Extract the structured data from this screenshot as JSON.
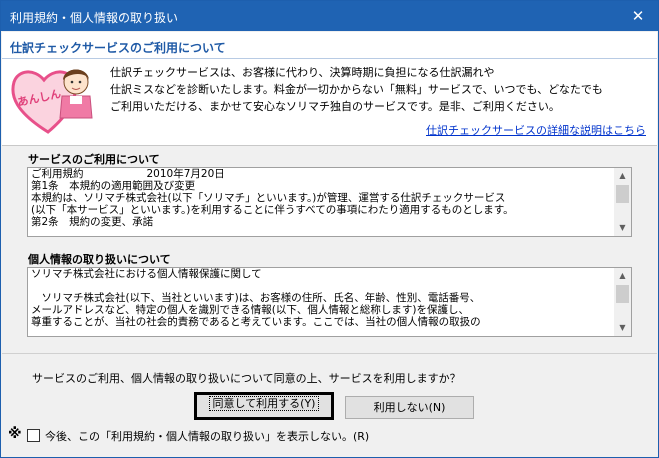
{
  "window": {
    "title": "利用規約・個人情報の取り扱い",
    "close_glyph": "✕"
  },
  "banner": {
    "heading": "仕訳チェックサービスのご利用について",
    "mascot_text": "あんしん",
    "lines": [
      "仕訳チェックサービスは、お客様に代わり、決算時期に負担になる仕訳漏れや",
      "仕訳ミスなどを診断いたします。料金が一切かからない「無料」サービスで、いつでも、どなたでも",
      "ご利用いただける、まかせて安心なソリマチ独自のサービスです。是非、ご利用ください。"
    ],
    "detail_link": "仕訳チェックサービスの詳細な説明はこちら"
  },
  "service_terms": {
    "label": "サービスのご利用について",
    "lines": [
      "ご利用規約　　　　　　2010年7月20日",
      "第1条　本規約の適用範囲及び変更",
      "本規約は、ソリマチ株式会社(以下「ソリマチ」といいます。)が管理、運営する仕訳チェックサービス",
      "(以下「本サービス」といいます。)を利用することに伴うすべての事項にわたり適用するものとします。",
      "第2条　規約の変更、承諾"
    ]
  },
  "privacy": {
    "label": "個人情報の取り扱いについて",
    "lines": [
      "ソリマチ株式会社における個人情報保護に関して",
      "",
      "　ソリマチ株式会社(以下、当社といいます)は、お客様の住所、氏名、年齢、性別、電話番号、",
      "メールアドレスなど、特定の個人を識別できる情報(以下、個人情報と総称します)を保護し、",
      "尊重することが、当社の社会的責務であると考えています。ここでは、当社の個人情報の取扱の"
    ]
  },
  "question": "サービスのご利用、個人情報の取り扱いについて同意の上、サービスを利用しますか？",
  "buttons": {
    "agree": "同意して利用する(Y)",
    "decline": "利用しない(N)"
  },
  "dont_show": {
    "mark": "※",
    "label": "今後、この「利用規約・個人情報の取り扱い」を表示しない。(R)",
    "checked": false
  },
  "colors": {
    "titlebar": "#1f63b3",
    "heading": "#1f5aa6",
    "link": "#0033cc"
  }
}
